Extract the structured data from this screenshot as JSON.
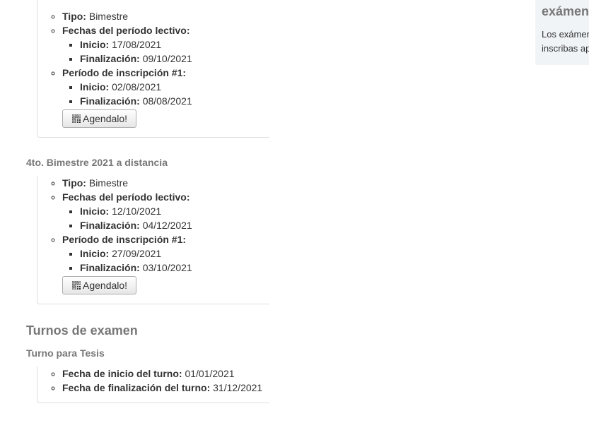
{
  "periods": [
    {
      "title": "",
      "tipo_label": "Tipo:",
      "tipo_value": "Bimestre",
      "fechas_label": "Fechas del período lectivo:",
      "inicio_label": "Inicio:",
      "inicio_value": "17/08/2021",
      "fin_label": "Finalización:",
      "fin_value": "09/10/2021",
      "inscripcion_label": "Período de inscripción #1:",
      "insc_inicio_label": "Inicio:",
      "insc_inicio_value": "02/08/2021",
      "insc_fin_label": "Finalización:",
      "insc_fin_value": "08/08/2021",
      "button_label": "Agendalo!",
      "button_icon": "qr-code-icon"
    },
    {
      "title": "4to. Bimestre 2021 a distancia",
      "tipo_label": "Tipo:",
      "tipo_value": "Bimestre",
      "fechas_label": "Fechas del período lectivo:",
      "inicio_label": "Inicio:",
      "inicio_value": "12/10/2021",
      "fin_label": "Finalización:",
      "fin_value": "04/12/2021",
      "inscripcion_label": "Período de inscripción #1:",
      "insc_inicio_label": "Inicio:",
      "insc_inicio_value": "27/09/2021",
      "insc_fin_label": "Finalización:",
      "insc_fin_value": "03/10/2021",
      "button_label": "Agendalo!",
      "button_icon": "qr-code-icon"
    }
  ],
  "exam_section": {
    "title": "Turnos de examen",
    "turno_title": "Turno para Tesis",
    "inicio_label": "Fecha de inicio del turno:",
    "inicio_value": "01/01/2021",
    "fin_label": "Fecha de finalización del turno:",
    "fin_value": "31/12/2021"
  },
  "side_panel": {
    "title": "exámen",
    "text_line1": "Los exámer",
    "text_line2": "inscribas ap"
  },
  "colors": {
    "heading": "#777777",
    "text": "#333333",
    "panel_bg": "#f1f4f7",
    "border": "#dddddd"
  }
}
